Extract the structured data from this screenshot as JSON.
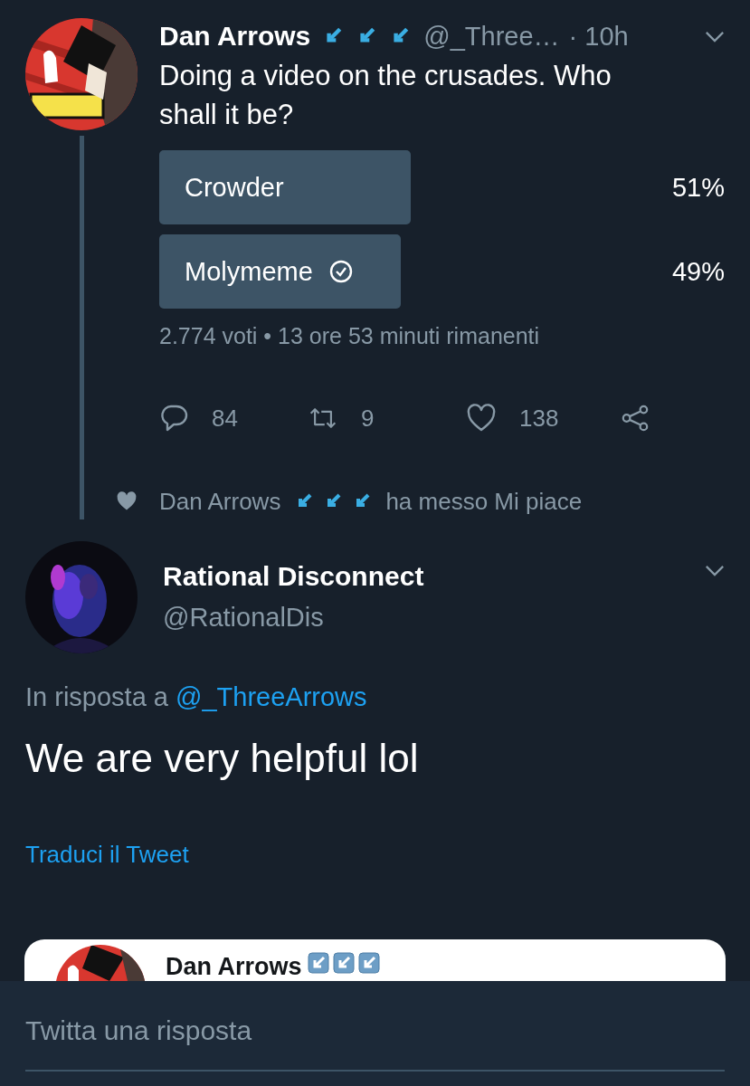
{
  "tweet": {
    "author": "Dan Arrows",
    "handle": "@_Three…",
    "time": "· 10h",
    "text": "Doing a video on the crusades. Who shall it be?",
    "poll": {
      "options": [
        {
          "label": "Crowder",
          "percent": "51%",
          "selected": false
        },
        {
          "label": "Molymeme",
          "percent": "49%",
          "selected": true
        }
      ],
      "summary": "2.774 voti • 13 ore 53 minuti rimanenti"
    },
    "actions": [
      {
        "kind": "reply",
        "count": "84"
      },
      {
        "kind": "retweet",
        "count": "9"
      },
      {
        "kind": "like",
        "count": "138"
      },
      {
        "kind": "share"
      }
    ]
  },
  "liked_by": {
    "name": "Dan Arrows",
    "text": "ha messo Mi piace"
  },
  "reply": {
    "author": "Rational Disconnect",
    "handle": "@RationalDis",
    "in_reply_prefix": "In risposta a",
    "in_reply_to": "@_ThreeArrows",
    "text": "We are very helpful lol",
    "translate": "Traduci il Tweet"
  },
  "quoted": {
    "author": "Dan Arrows"
  },
  "composer": {
    "placeholder": "Twitta una risposta"
  }
}
